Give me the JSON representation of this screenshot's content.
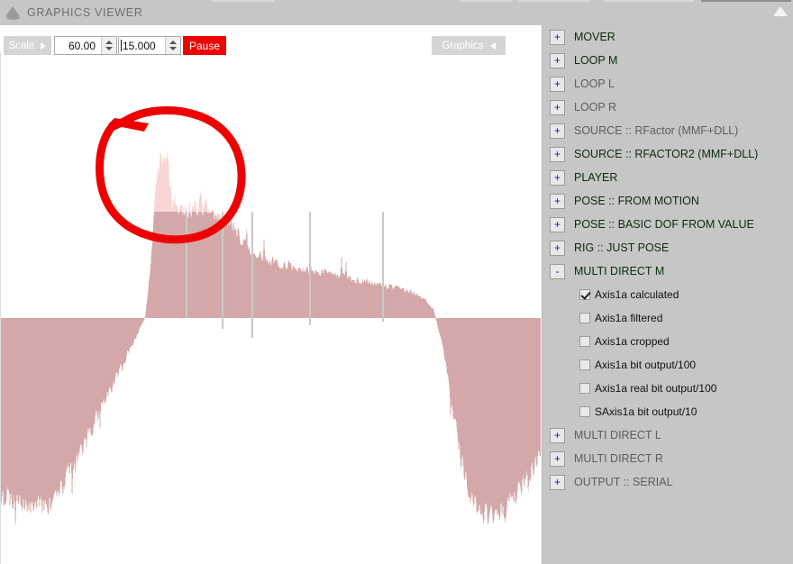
{
  "window": {
    "title": "GRAPHICS VIEWER",
    "app_icon": "cone-icon",
    "scroll_up_icon": "triangle-up-icon"
  },
  "toolbar": {
    "scale_label": "Scale",
    "scale_arrow_icon": "triangle-right-icon",
    "field_scale": {
      "value": "60.00",
      "placeholder": "60.00"
    },
    "field_range": {
      "value": "15.000",
      "placeholder": "15.000"
    },
    "spinner_up_icon": "triangle-up-icon",
    "spinner_down_icon": "triangle-down-icon",
    "pause_label": "Pause",
    "pause_color": "#f10000",
    "graphics_label": "Graphics",
    "graphics_arrow_icon": "triangle-left-icon"
  },
  "annotation": {
    "shape": "hand-drawn-red-circle",
    "color": "#ee0000"
  },
  "tree": {
    "nodes": [
      {
        "label": "MOVER",
        "expander": "+",
        "state": "on"
      },
      {
        "label": "LOOP M",
        "expander": "+",
        "state": "on"
      },
      {
        "label": "LOOP L",
        "expander": "+",
        "state": "off"
      },
      {
        "label": "LOOP R",
        "expander": "+",
        "state": "off"
      },
      {
        "label": "SOURCE :: RFactor (MMF+DLL)",
        "expander": "+",
        "state": "off"
      },
      {
        "label": "SOURCE :: RFACTOR2 (MMF+DLL)",
        "expander": "+",
        "state": "on"
      },
      {
        "label": "PLAYER",
        "expander": "+",
        "state": "on"
      },
      {
        "label": "POSE :: FROM MOTION",
        "expander": "+",
        "state": "on"
      },
      {
        "label": "POSE :: BASIC DOF FROM VALUE",
        "expander": "+",
        "state": "on"
      },
      {
        "label": "RIG :: JUST POSE",
        "expander": "+",
        "state": "on"
      },
      {
        "label": "MULTI DIRECT M",
        "expander": "-",
        "state": "on"
      }
    ],
    "children": [
      {
        "label": "Axis1a calculated",
        "checked": true
      },
      {
        "label": "Axis1a filtered",
        "checked": false
      },
      {
        "label": "Axis1a cropped",
        "checked": false
      },
      {
        "label": "Axis1a bit output/100",
        "checked": false
      },
      {
        "label": "Axis1a real bit output/100",
        "checked": false
      },
      {
        "label": "SAxis1a bit output/10",
        "checked": false
      }
    ],
    "nodes_tail": [
      {
        "label": "MULTI DIRECT L",
        "expander": "+",
        "state": "off"
      },
      {
        "label": "MULTI DIRECT R",
        "expander": "+",
        "state": "off"
      },
      {
        "label": "OUTPUT :: SERIAL",
        "expander": "+",
        "state": "off"
      }
    ]
  },
  "chart_data": {
    "type": "area",
    "title": "",
    "xlabel": "",
    "ylabel": "",
    "grid": false,
    "legend": null,
    "baseline_y": 325,
    "colors": {
      "upper_fill": "#f9d5d5",
      "lower_fill": "#d4a8a8",
      "background": "#ffffff"
    },
    "series": [
      {
        "name": "Axis1a calculated",
        "description": "Oscilloscope-style signal trace, positive lobe centered on a tall transient peak near x=185 and a long decaying tail, plus mirrored negative lobes at the far left and far right.",
        "x": [
          0,
          10,
          20,
          30,
          40,
          50,
          60,
          70,
          80,
          90,
          100,
          110,
          120,
          130,
          140,
          150,
          160,
          165,
          170,
          175,
          180,
          185,
          190,
          195,
          200,
          210,
          220,
          230,
          240,
          250,
          260,
          270,
          280,
          290,
          300,
          310,
          320,
          330,
          340,
          350,
          360,
          370,
          380,
          390,
          400,
          410,
          420,
          430,
          440,
          450,
          460,
          470,
          480,
          490,
          500,
          510,
          520,
          530,
          540,
          550,
          560,
          570,
          580,
          590,
          600
        ],
        "values": [
          -190,
          -195,
          -200,
          -205,
          -205,
          -205,
          -198,
          -180,
          -160,
          -140,
          -120,
          -100,
          -80,
          -60,
          -40,
          -20,
          0,
          45,
          120,
          165,
          180,
          175,
          120,
          118,
          118,
          118,
          118,
          118,
          112,
          108,
          95,
          80,
          72,
          66,
          60,
          58,
          56,
          54,
          52,
          50,
          48,
          46,
          44,
          42,
          40,
          38,
          36,
          34,
          32,
          30,
          26,
          20,
          10,
          -30,
          -90,
          -150,
          -190,
          -210,
          -215,
          -212,
          -205,
          -195,
          -180,
          -165,
          -150
        ]
      }
    ]
  }
}
